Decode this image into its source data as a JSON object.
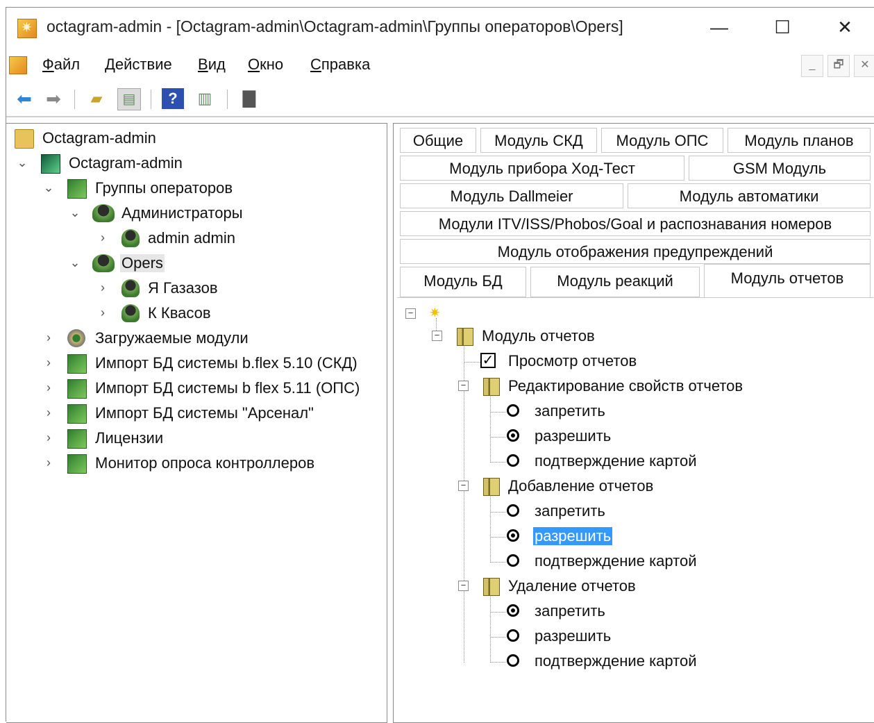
{
  "window": {
    "title": "octagram-admin - [Octagram-admin\\Octagram-admin\\Группы операторов\\Opers]",
    "controls": {
      "minimize": "—",
      "maximize": "☐",
      "close": "✕"
    }
  },
  "menu": {
    "items": [
      {
        "accel": "Ф",
        "rest": "айл"
      },
      {
        "accel": "Д",
        "rest": "ействие"
      },
      {
        "accel": "В",
        "rest": "ид"
      },
      {
        "accel": "О",
        "rest": "кно"
      },
      {
        "accel": "С",
        "rest": "правка"
      }
    ],
    "mdi": {
      "minimize": "_",
      "restore": "🗗",
      "close": "✕"
    }
  },
  "toolbar": {
    "buttons": [
      "back-icon",
      "forward-icon",
      "up-folder-icon",
      "show-hide-tree-icon",
      "help-icon",
      "properties-icon",
      "save-icon"
    ]
  },
  "tree": {
    "root": "Octagram-admin",
    "node": "Octagram-admin",
    "groups": "Группы операторов",
    "admins": "Администраторы",
    "admin_user": "admin admin",
    "opers": "Opers",
    "user1": "Я Газазов",
    "user2": "К Квасов",
    "modules": "Загружаемые модули",
    "import1": "Импорт БД системы b.flex 5.10 (СКД)",
    "import2": "Импорт БД системы b flex 5.11 (ОПС)",
    "import3": "Импорт БД системы \"Арсенал\"",
    "licenses": "Лицензии",
    "monitor": "Монитор опроса контроллеров"
  },
  "tabs": {
    "row1": [
      "Общие",
      "Модуль СКД",
      "Модуль ОПС",
      "Модуль планов"
    ],
    "row2": [
      "Модуль прибора Ход-Тест",
      "GSM Модуль"
    ],
    "row3": [
      "Модуль Dallmeier",
      "Модуль автоматики"
    ],
    "row4": [
      "Модули ITV/ISS/Phobos/Goal и распознавания номеров"
    ],
    "row5": [
      "Модуль отображения предупреждений"
    ],
    "row6": [
      "Модуль БД",
      "Модуль реакций",
      "Модуль отчетов"
    ],
    "active": "Модуль отчетов"
  },
  "permissions": {
    "root_label": "Модуль отчетов",
    "view": {
      "label": "Просмотр отчетов",
      "checked": true
    },
    "groups": [
      {
        "label": "Редактирование свойств отчетов",
        "options": [
          "запретить",
          "разрешить",
          "подтверждение картой"
        ],
        "selected": 1
      },
      {
        "label": "Добавление отчетов",
        "options": [
          "запретить",
          "разрешить",
          "подтверждение картой"
        ],
        "selected": 1
      },
      {
        "label": "Удаление отчетов",
        "options": [
          "запретить",
          "разрешить",
          "подтверждение картой"
        ],
        "selected": 0
      }
    ]
  },
  "colors": {
    "selection": "#3399ff",
    "tree_selection": "#e6e6e6"
  }
}
